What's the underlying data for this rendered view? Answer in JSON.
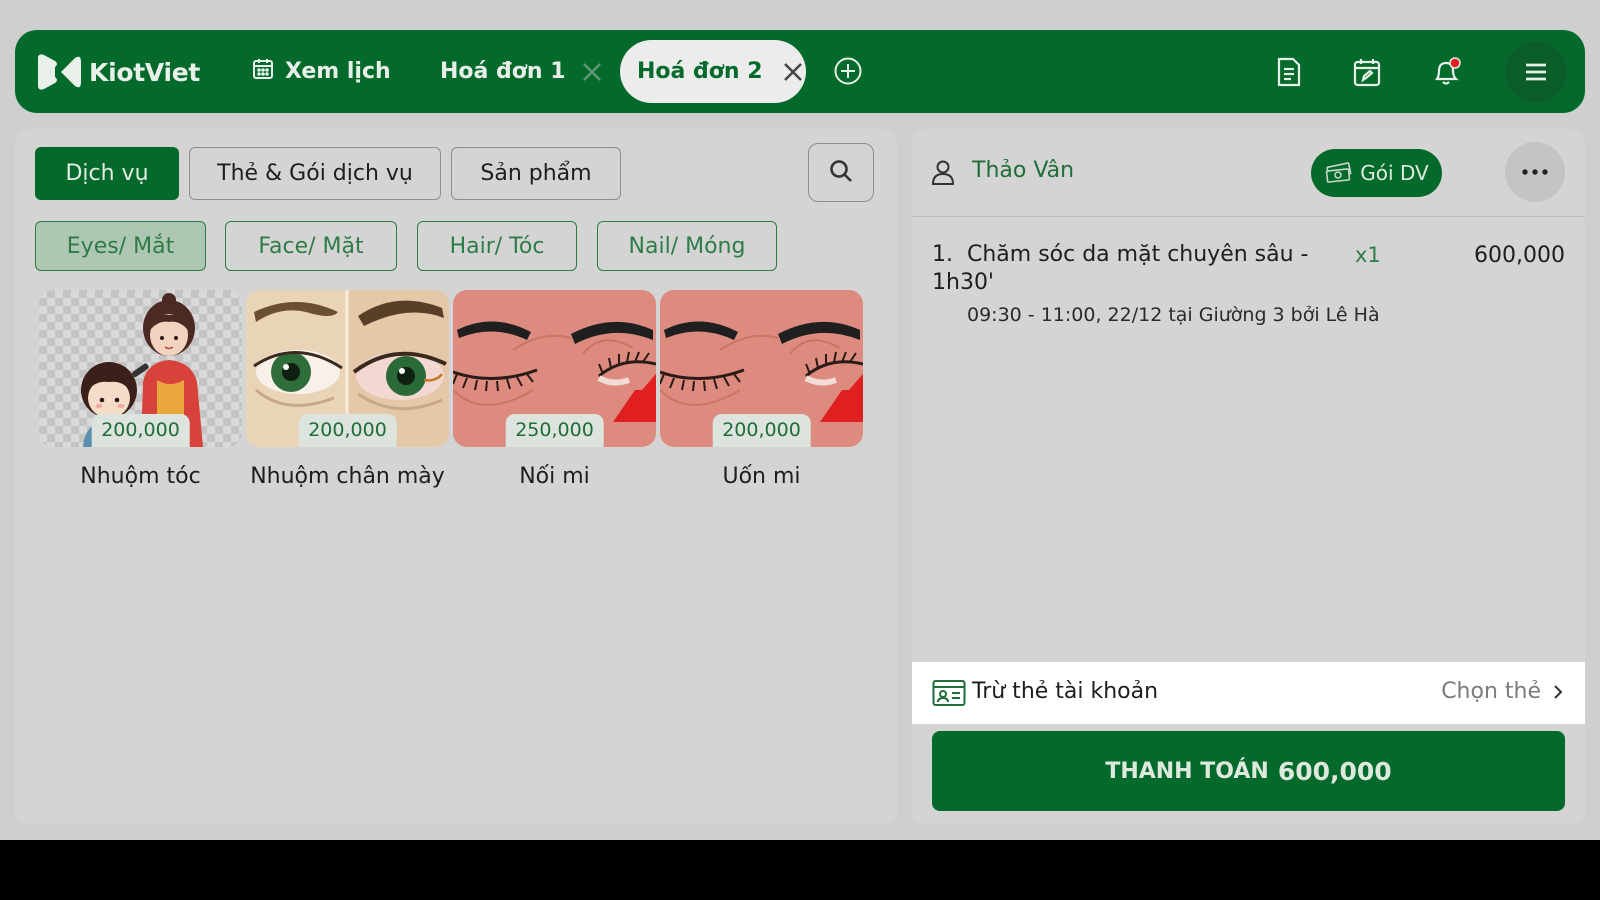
{
  "colors": {
    "brand_green": "#046a2b",
    "accent_red": "#e02020",
    "background": "#cfcfcf"
  },
  "topbar": {
    "brand": "KiotViet",
    "tabs": [
      {
        "label": "Xem lịch",
        "icon": "calendar-icon"
      },
      {
        "label": "Hoá đơn 1",
        "closable": true
      },
      {
        "label": "Hoá đơn 2",
        "closable": true,
        "active": true
      }
    ],
    "icons": [
      "add-tab-icon",
      "invoice-icon",
      "calendar-edit-icon",
      "bell-icon",
      "hamburger-menu-icon"
    ]
  },
  "categories": [
    {
      "label": "Dịch vụ",
      "active": true
    },
    {
      "label": "Thẻ & Gói dịch vụ"
    },
    {
      "label": "Sản phẩm"
    }
  ],
  "subcategories": [
    {
      "label": "Eyes/ Mắt",
      "active": true
    },
    {
      "label": "Face/ Mặt"
    },
    {
      "label": "Hair/ Tóc"
    },
    {
      "label": "Nail/ Móng"
    }
  ],
  "services": [
    {
      "name": "Nhuộm tóc",
      "price": "200,000"
    },
    {
      "name": "Nhuộm chân mày",
      "price": "200,000"
    },
    {
      "name": "Nối mi",
      "price": "250,000"
    },
    {
      "name": "Uốn mi",
      "price": "200,000"
    }
  ],
  "order": {
    "customer": "Thảo Vân",
    "package_button": "Gói DV",
    "items": [
      {
        "index": "1.",
        "name": "Chăm sóc da mặt chuyên sâu - 1h30'",
        "qty": "x1",
        "price": "600,000",
        "detail": "09:30 - 11:00, 22/12 tại Giường 3 bởi Lê Hà"
      }
    ],
    "card_deduct_label": "Trừ thẻ tài khoản",
    "card_choose_label": "Chọn thẻ",
    "pay_label": "THANH TOÁN",
    "pay_amount": "600,000"
  }
}
